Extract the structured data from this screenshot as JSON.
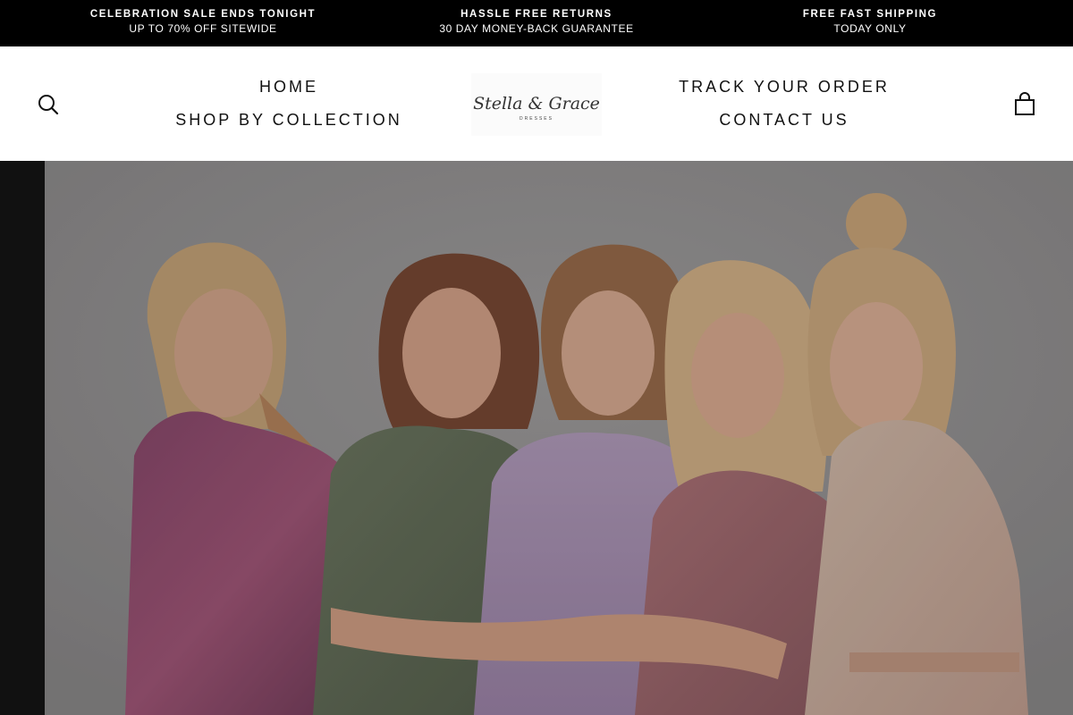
{
  "announcement": {
    "promos": [
      {
        "title": "CELEBRATION SALE ENDS TONIGHT",
        "subtitle": "UP TO 70% OFF SITEWIDE"
      },
      {
        "title": "HASSLE FREE RETURNS",
        "subtitle": "30 DAY MONEY-BACK GUARANTEE"
      },
      {
        "title": "FREE FAST SHIPPING",
        "subtitle": "TODAY ONLY"
      }
    ]
  },
  "header": {
    "nav_left": [
      {
        "label": "HOME"
      },
      {
        "label": "SHOP BY COLLECTION"
      }
    ],
    "nav_right": [
      {
        "label": "TRACK YOUR ORDER"
      },
      {
        "label": "CONTACT US"
      }
    ],
    "logo": {
      "text": "Stella & Grace",
      "tagline": "DRESSES"
    },
    "icons": {
      "search": "search-icon",
      "cart": "shopping-bag-icon"
    }
  },
  "hero": {
    "image": "five-women-in-floral-dresses-embracing"
  },
  "colors": {
    "announcement_bg": "#000000",
    "header_bg": "#ffffff",
    "hero_backdrop": "#9a9898"
  }
}
